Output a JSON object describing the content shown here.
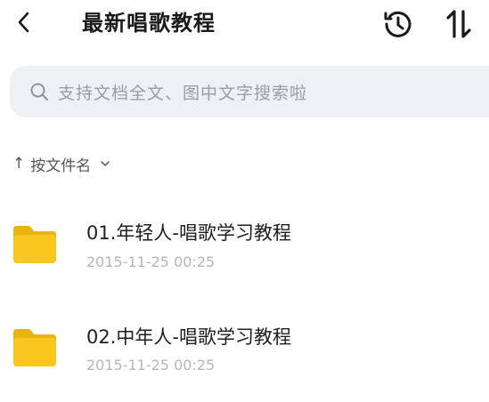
{
  "header": {
    "title": "最新唱歌教程"
  },
  "search": {
    "placeholder": "支持文档全文、图中文字搜索啦"
  },
  "sort": {
    "arrow": "↑",
    "label": "按文件名"
  },
  "files": [
    {
      "name": "01.年轻人-唱歌学习教程",
      "date": "2015-11-25 00:25"
    },
    {
      "name": "02.中年人-唱歌学习教程",
      "date": "2015-11-25 00:25"
    }
  ],
  "colors": {
    "folder": "#f6c21b",
    "search_bg": "#eef0f5",
    "muted_text": "#b3b6bd"
  },
  "icons": {
    "back": "chevron-left-icon",
    "history": "history-icon",
    "sort": "sort-arrows-icon",
    "search": "search-icon",
    "sort_dropdown": "chevron-down-icon",
    "folder": "folder-icon"
  }
}
